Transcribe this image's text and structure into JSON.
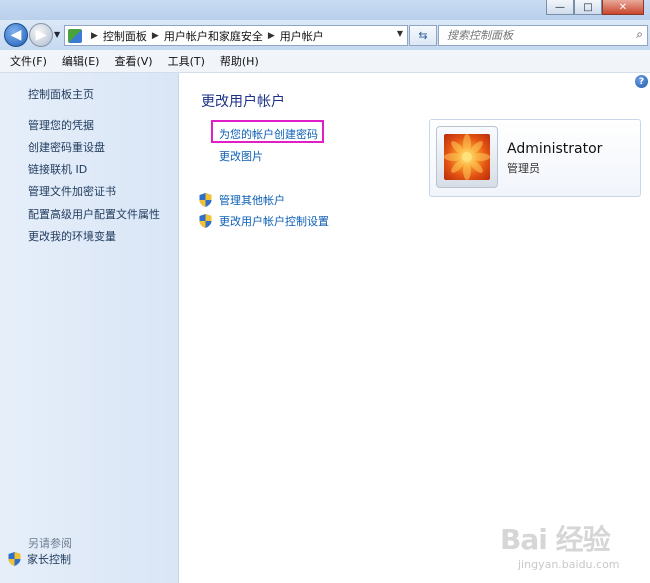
{
  "window": {
    "caption_min": "—",
    "caption_max": "□",
    "caption_close": "✕"
  },
  "address_bar": {
    "crumbs": [
      "控制面板",
      "用户帐户和家庭安全",
      "用户帐户"
    ]
  },
  "search": {
    "placeholder": "搜索控制面板"
  },
  "menu": [
    "文件(F)",
    "编辑(E)",
    "查看(V)",
    "工具(T)",
    "帮助(H)"
  ],
  "left_pane": {
    "home": "控制面板主页",
    "links": [
      "管理您的凭据",
      "创建密码重设盘",
      "链接联机 ID",
      "管理文件加密证书",
      "配置高级用户配置文件属性",
      "更改我的环境变量"
    ],
    "see_also": "另请参阅",
    "parental_controls": "家长控制"
  },
  "main": {
    "heading": "更改用户帐户",
    "tasks": [
      "为您的帐户创建密码",
      "更改图片"
    ],
    "admin_tasks": [
      "管理其他帐户",
      "更改用户帐户控制设置"
    ]
  },
  "account": {
    "name": "Administrator",
    "role": "管理员"
  },
  "watermark": {
    "logo": "Bai 经验",
    "url": "jingyan.baidu.com"
  },
  "colors": {
    "highlight_border": "#e020c6",
    "link": "#0d5fb5",
    "heading": "#1e3287"
  }
}
